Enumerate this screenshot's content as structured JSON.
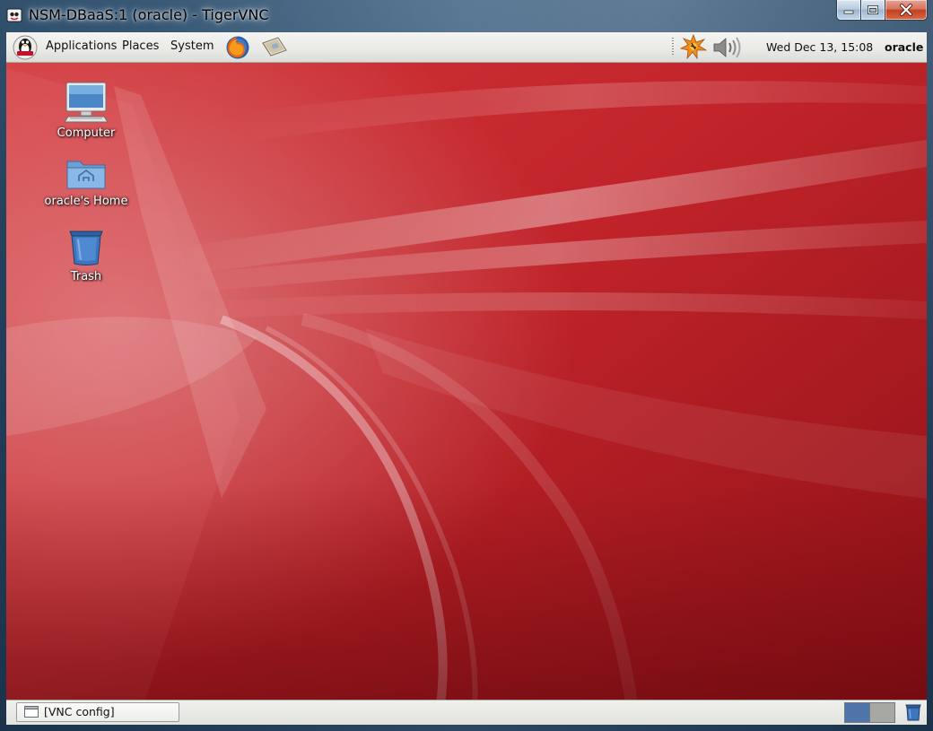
{
  "window": {
    "title": "NSM-DBaaS:1 (oracle) - TigerVNC",
    "controls": [
      "minimize-icon",
      "maximize-icon",
      "close-icon"
    ],
    "frame_color": "#2b4d6e",
    "close_color": "#c2401f"
  },
  "top_panel": {
    "menus": [
      {
        "label": "Applications"
      },
      {
        "label": "Places"
      },
      {
        "label": "System"
      }
    ],
    "launchers": [
      "firefox-icon",
      "email-icon"
    ],
    "tray_icons": [
      "update-notifier-icon",
      "volume-icon"
    ],
    "clock": "Wed Dec 13, 15:08",
    "user": "oracle"
  },
  "desktop": {
    "wallpaper_color": "#b21a1e",
    "icons": [
      {
        "label": "Computer",
        "icon": "computer-icon"
      },
      {
        "label": "oracle's Home",
        "icon": "home-folder-icon"
      },
      {
        "label": "Trash",
        "icon": "trash-icon"
      }
    ]
  },
  "bottom_panel": {
    "tasks": [
      {
        "label": "[VNC config]",
        "icon": "window-icon"
      }
    ],
    "workspaces": [
      "workspace-1",
      "workspace-2"
    ],
    "active_workspace": 1,
    "trash_applet": "trash-applet-icon"
  }
}
